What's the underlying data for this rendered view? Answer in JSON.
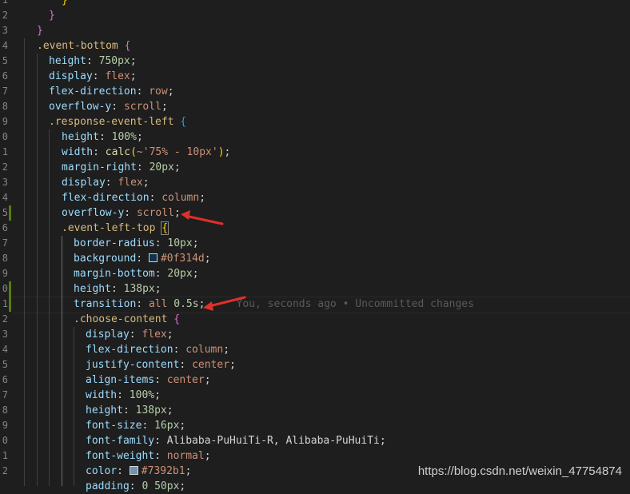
{
  "line_numbers": [
    "1",
    "2",
    "3",
    "4",
    "5",
    "6",
    "7",
    "8",
    "9",
    "0",
    "1",
    "2",
    "3",
    "4",
    "5",
    "6",
    "7",
    "8",
    "9",
    "0",
    "1",
    "2",
    "3",
    "4",
    "5",
    "6",
    "7",
    "8",
    "9",
    "0",
    "1",
    "2"
  ],
  "code": {
    "l0_brace": "}",
    "l1_brace": "}",
    "l2_brace": "}",
    "l3_sel": ".event-bottom",
    "l3_brace": "{",
    "l4_prop": "height",
    "l4_val": "750px",
    "l5_prop": "display",
    "l5_val": "flex",
    "l6_prop": "flex-direction",
    "l6_val": "row",
    "l7_prop": "overflow-y",
    "l7_val": "scroll",
    "l8_sel": ".response-event-left",
    "l8_brace": "{",
    "l9_prop": "height",
    "l9_val": "100%",
    "l10_prop": "width",
    "l10_fn": "calc",
    "l10_str": "~'75% - 10px'",
    "l11_prop": "margin-right",
    "l11_val": "20px",
    "l12_prop": "display",
    "l12_val": "flex",
    "l13_prop": "flex-direction",
    "l13_val": "column",
    "l14_prop": "overflow-y",
    "l14_val": "scroll",
    "l15_sel": ".event-left-top",
    "l15_brace": "{",
    "l16_prop": "border-radius",
    "l16_val": "10px",
    "l17_prop": "background",
    "l17_val": "#0f314d",
    "l18_prop": "margin-bottom",
    "l18_val": "20px",
    "l19_prop": "height",
    "l19_val": "138px",
    "l20_prop": "transition",
    "l20_val1": "all",
    "l20_val2": "0.5s",
    "l20_blame": "You, seconds ago • Uncommitted changes",
    "l21_sel": ".choose-content",
    "l21_brace": "{",
    "l22_prop": "display",
    "l22_val": "flex",
    "l23_prop": "flex-direction",
    "l23_val": "column",
    "l24_prop": "justify-content",
    "l24_val": "center",
    "l25_prop": "align-items",
    "l25_val": "center",
    "l26_prop": "width",
    "l26_val": "100%",
    "l27_prop": "height",
    "l27_val": "138px",
    "l28_prop": "font-size",
    "l28_val": "16px",
    "l29_prop": "font-family",
    "l29_val": "Alibaba-PuHuiTi-R, Alibaba-PuHuiTi",
    "l30_prop": "font-weight",
    "l30_val": "normal",
    "l31_prop": "color",
    "l31_val": "#7392b1",
    "l32_prop": "padding",
    "l32_val": "0 50px"
  },
  "colors": {
    "swatch_background": "#0f314d",
    "swatch_color": "#7392b1",
    "arrow": "#e0302b"
  },
  "watermark": "https://blog.csdn.net/weixin_47754874"
}
